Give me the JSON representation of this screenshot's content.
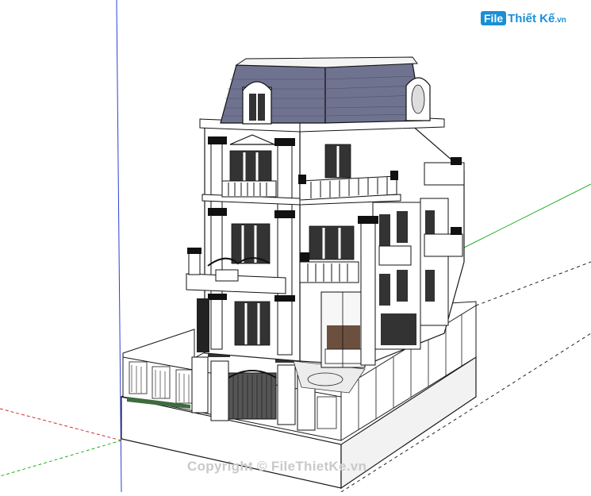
{
  "watermark": {
    "logo_badge": "File",
    "logo_rest": "Thiết Kế",
    "logo_suffix": ".vn",
    "copyright": "Copyright © FileThietKe.vn"
  },
  "scene": {
    "description_hidden": "",
    "axis_colors": {
      "blue": "#2b3fd6",
      "green": "#22b022",
      "red": "#d13030"
    },
    "roof_color": "#6f7390",
    "wall_color": "#ffffff",
    "trim_color": "#1a1a1a",
    "lawn_color": "#3f6b3f",
    "glass_color": "#6b5040"
  }
}
